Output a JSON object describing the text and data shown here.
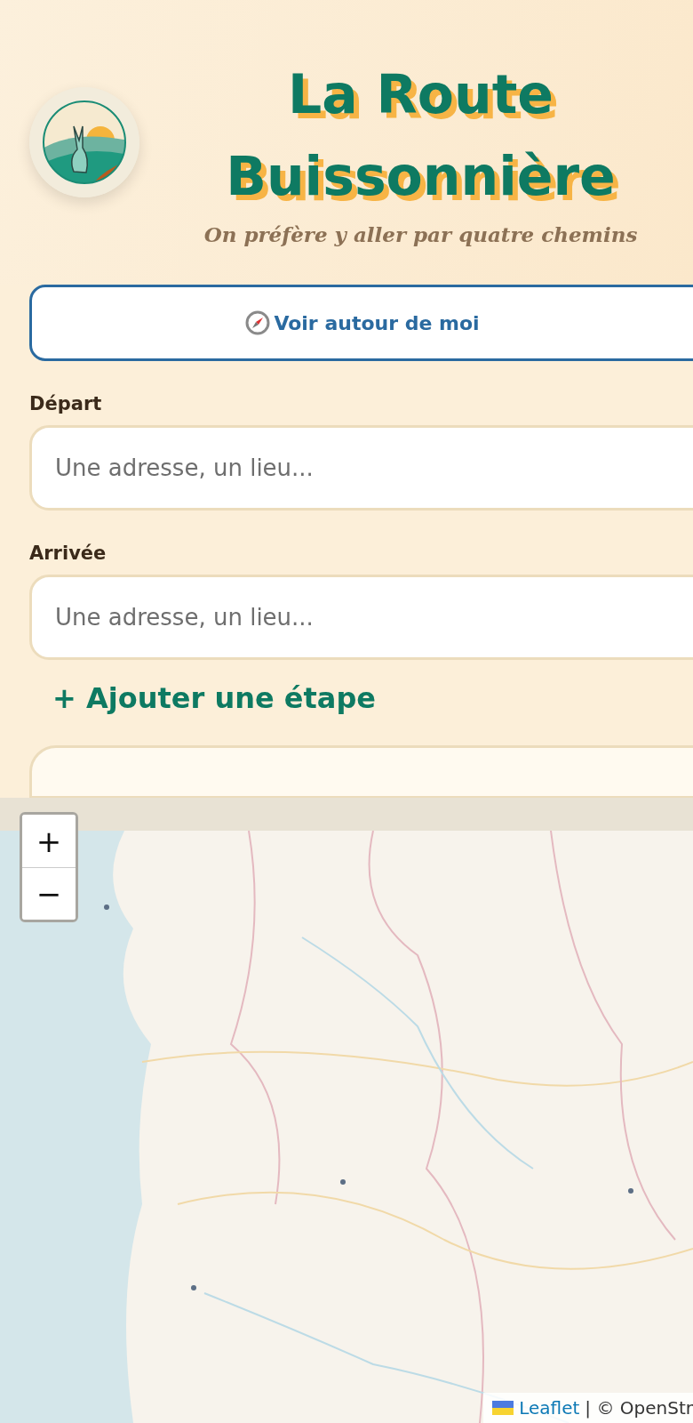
{
  "header": {
    "title_lines": [
      "La Route",
      "Buissonnière"
    ],
    "tagline": "On préfère y aller par quatre chemins"
  },
  "locate_button": {
    "label": "Voir autour de moi"
  },
  "fields": [
    {
      "label": "Départ",
      "placeholder": "Une adresse, un lieu..."
    },
    {
      "label": "Arrivée",
      "placeholder": "Une adresse, un lieu..."
    }
  ],
  "add_stop": {
    "label": "+ Ajouter une étape"
  },
  "map": {
    "kind": "picture",
    "zoom_in": "+",
    "zoom_out": "−",
    "attribution_link": "Leaflet",
    "attribution_text": "| © OpenStr"
  }
}
